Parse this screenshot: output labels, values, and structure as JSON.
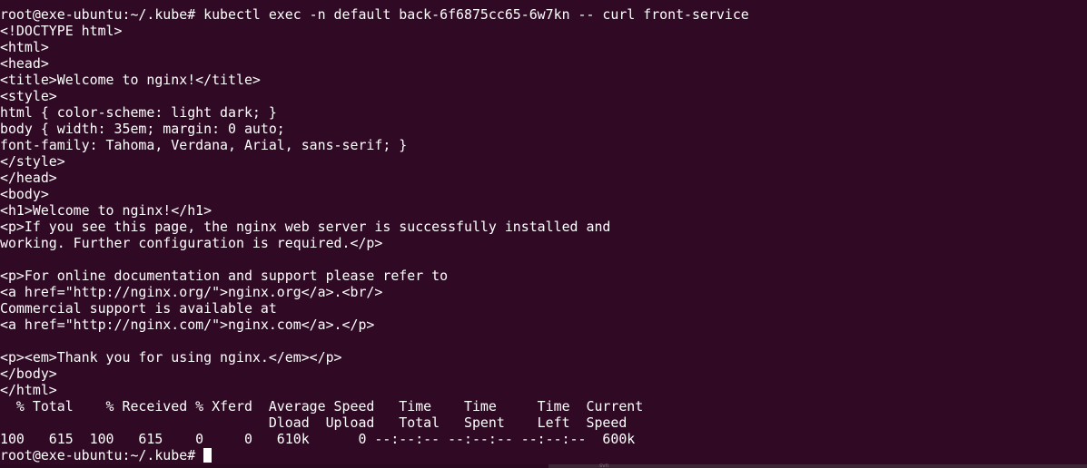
{
  "theme": {
    "background": "#300a24",
    "foreground": "#ffffff"
  },
  "terminal": {
    "lines": [
      "root@exe-ubuntu:~/.kube# kubectl exec -n default back-6f6875cc65-6w7kn -- curl front-service",
      "<!DOCTYPE html>",
      "<html>",
      "<head>",
      "<title>Welcome to nginx!</title>",
      "<style>",
      "html { color-scheme: light dark; }",
      "body { width: 35em; margin: 0 auto;",
      "font-family: Tahoma, Verdana, Arial, sans-serif; }",
      "</style>",
      "</head>",
      "<body>",
      "<h1>Welcome to nginx!</h1>",
      "<p>If you see this page, the nginx web server is successfully installed and",
      "working. Further configuration is required.</p>",
      "",
      "<p>For online documentation and support please refer to",
      "<a href=\"http://nginx.org/\">nginx.org</a>.<br/>",
      "Commercial support is available at",
      "<a href=\"http://nginx.com/\">nginx.com</a>.</p>",
      "",
      "<p><em>Thank you for using nginx.</em></p>",
      "</body>",
      "</html>",
      "  % Total    % Received % Xferd  Average Speed   Time    Time     Time  Current",
      "                                 Dload  Upload   Total   Spent    Left  Speed",
      "100   615  100   615    0     0   610k      0 --:--:-- --:--:-- --:--:--  600k"
    ],
    "prompt": "root@exe-ubuntu:~/.kube# "
  },
  "footer": {
    "ghost_label": "svn"
  }
}
